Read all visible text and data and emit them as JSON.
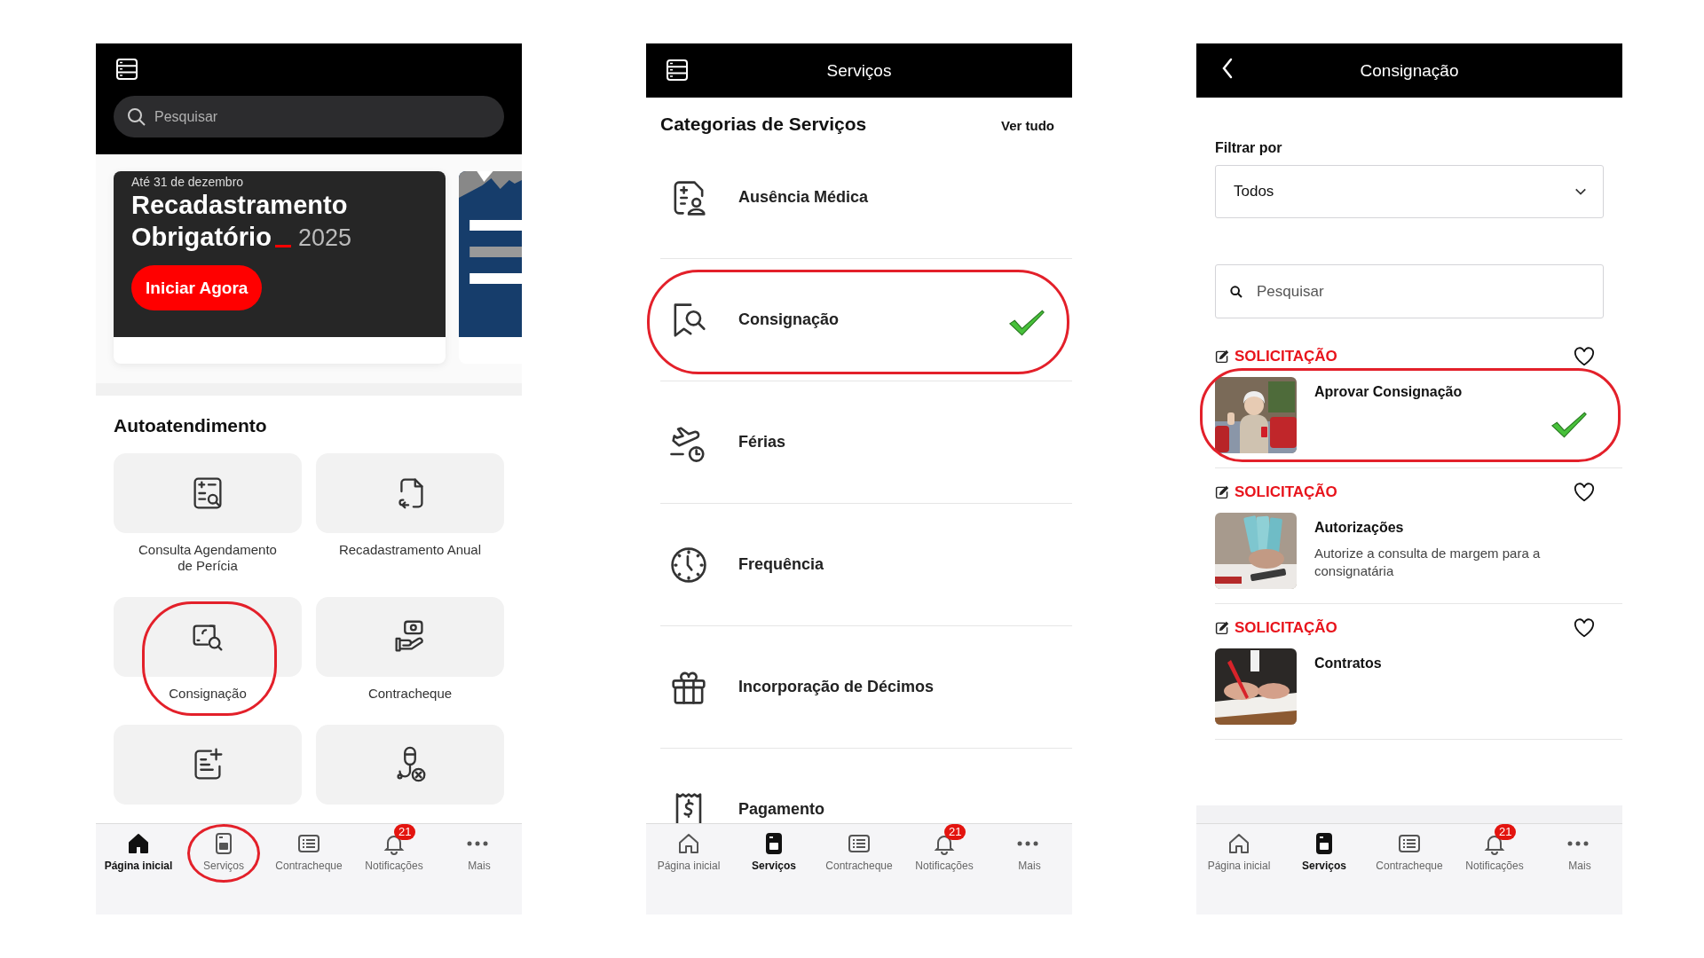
{
  "screens": [
    {
      "kind": "home",
      "search": {
        "placeholder": "Pesquisar"
      },
      "banner": {
        "date": "Até 31 de dezembro",
        "title_line_1": "Recadastramento",
        "title_line_2": "Obrigatório",
        "year": "2025",
        "button": "Iniciar Agora"
      },
      "section_title": "Autoatendimento",
      "tiles": [
        {
          "label": "Consulta Agendamento de Perícia",
          "circled": false
        },
        {
          "label": "Recadastramento Anual",
          "circled": false
        },
        {
          "label": "Consignação",
          "circled": true
        },
        {
          "label": "Contracheque",
          "circled": false
        },
        {
          "circled": false
        },
        {
          "circled": false
        }
      ],
      "tabs": [
        {
          "label": "Página inicial",
          "selected": true,
          "circled": false
        },
        {
          "label": "Serviços",
          "selected": false,
          "circled": true
        },
        {
          "label": "Contracheque",
          "selected": false,
          "circled": false
        },
        {
          "label": "Notificações",
          "selected": false,
          "circled": false,
          "badge": "21"
        },
        {
          "label": "Mais",
          "selected": false,
          "circled": false
        }
      ]
    },
    {
      "kind": "services",
      "title": "Serviços",
      "section_title": "Categorias de Serviços",
      "see_all": "Ver tudo",
      "categories": [
        {
          "label": "Ausência Médica",
          "circled": false,
          "ticked": false
        },
        {
          "label": "Consignação",
          "circled": true,
          "ticked": true
        },
        {
          "label": "Férias",
          "circled": false,
          "ticked": false
        },
        {
          "label": "Frequência",
          "circled": false,
          "ticked": false
        },
        {
          "label": "Incorporação de Décimos",
          "circled": false,
          "ticked": false
        },
        {
          "label": "Pagamento",
          "circled": false,
          "ticked": false
        }
      ],
      "tabs": [
        {
          "label": "Página inicial",
          "selected": false,
          "circled": false
        },
        {
          "label": "Serviços",
          "selected": true,
          "circled": false
        },
        {
          "label": "Contracheque",
          "selected": false,
          "circled": false
        },
        {
          "label": "Notificações",
          "selected": false,
          "circled": false,
          "badge": "21"
        },
        {
          "label": "Mais",
          "selected": false,
          "circled": false
        }
      ]
    },
    {
      "kind": "consignment",
      "title": "Consignação",
      "filter": {
        "label": "Filtrar por",
        "value": "Todos"
      },
      "search": {
        "placeholder": "Pesquisar"
      },
      "items": [
        {
          "category": "SOLICITAÇÃO",
          "title": "Aprovar Consignação",
          "favorite": false,
          "circled": true,
          "ticked": true
        },
        {
          "category": "SOLICITAÇÃO",
          "title": "Autorizações",
          "description": "Autorize a consulta de margem para a consignatária",
          "favorite": false,
          "circled": false,
          "ticked": false
        },
        {
          "category": "SOLICITAÇÃO",
          "title": "Contratos",
          "favorite": false,
          "circled": false,
          "ticked": false
        }
      ],
      "tabs": [
        {
          "label": "Página inicial",
          "selected": false,
          "circled": false
        },
        {
          "label": "Serviços",
          "selected": true,
          "circled": false
        },
        {
          "label": "Contracheque",
          "selected": false,
          "circled": false
        },
        {
          "label": "Notificações",
          "selected": false,
          "circled": false,
          "badge": "21"
        },
        {
          "label": "Mais",
          "selected": false,
          "circled": false
        }
      ]
    }
  ]
}
